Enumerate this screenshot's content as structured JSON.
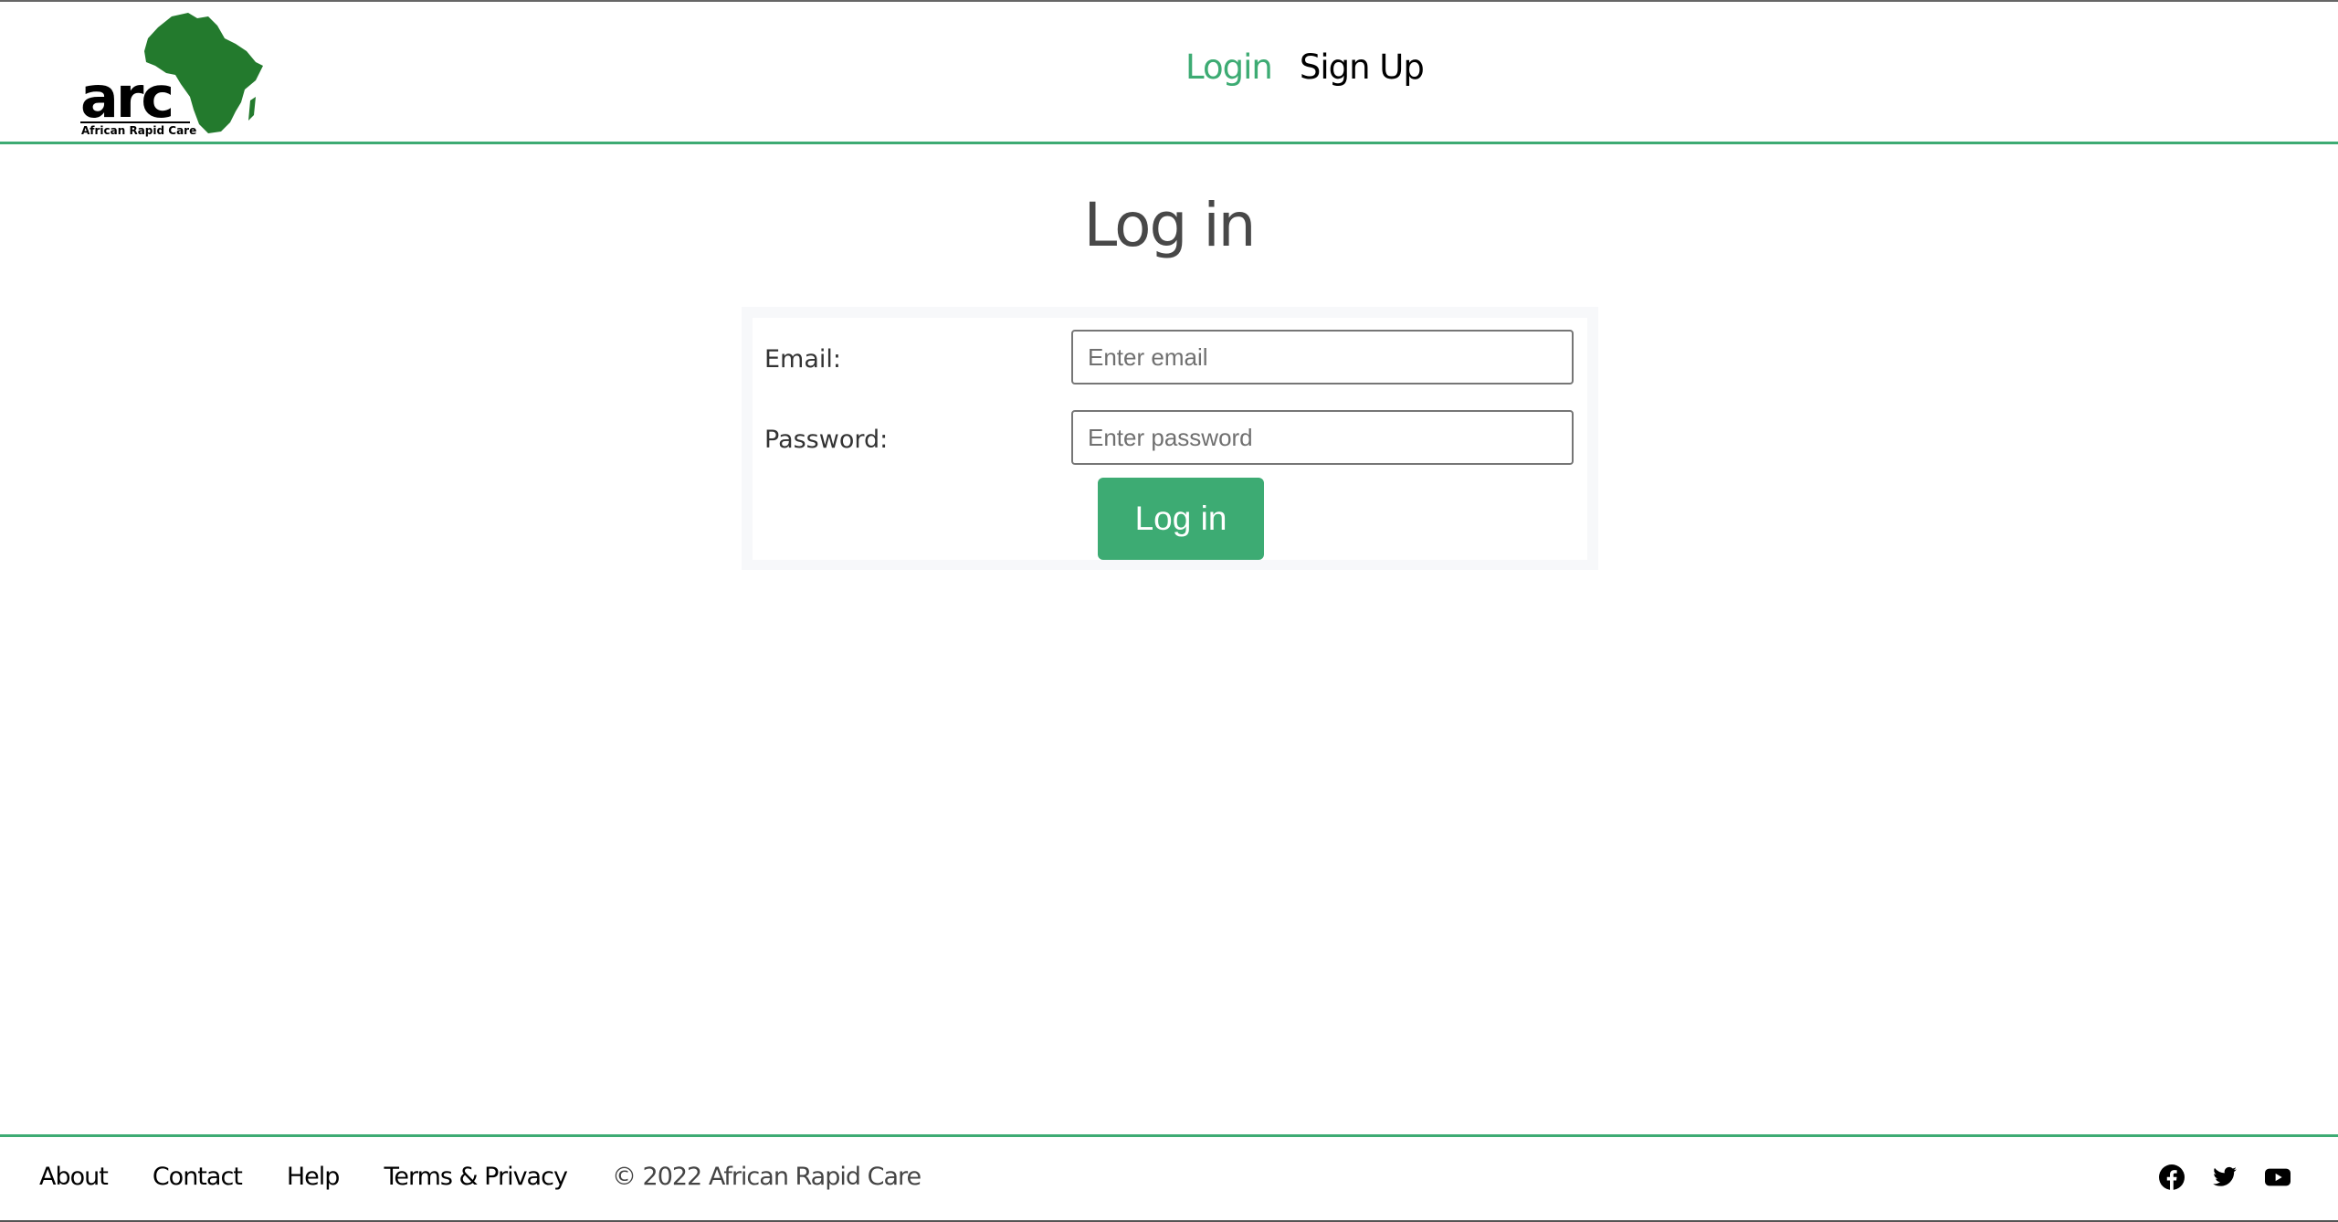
{
  "header": {
    "logo": {
      "wordmark": "arc",
      "tagline": "African Rapid Care",
      "brand_color": "#237a2d"
    },
    "nav": [
      {
        "label": "Login",
        "active": true
      },
      {
        "label": "Sign Up",
        "active": false
      }
    ]
  },
  "main": {
    "title": "Log in",
    "form": {
      "email_label": "Email:",
      "email_placeholder": "Enter email",
      "email_value": "",
      "password_label": "Password:",
      "password_placeholder": "Enter password",
      "password_value": "",
      "submit_label": "Log in"
    }
  },
  "footer": {
    "links": [
      "About",
      "Contact",
      "Help",
      "Terms & Privacy"
    ],
    "copyright": "© 2022 African Rapid Care",
    "social": [
      "facebook-icon",
      "twitter-icon",
      "youtube-icon"
    ]
  },
  "colors": {
    "accent": "#3dab73",
    "title_text": "#484848"
  }
}
